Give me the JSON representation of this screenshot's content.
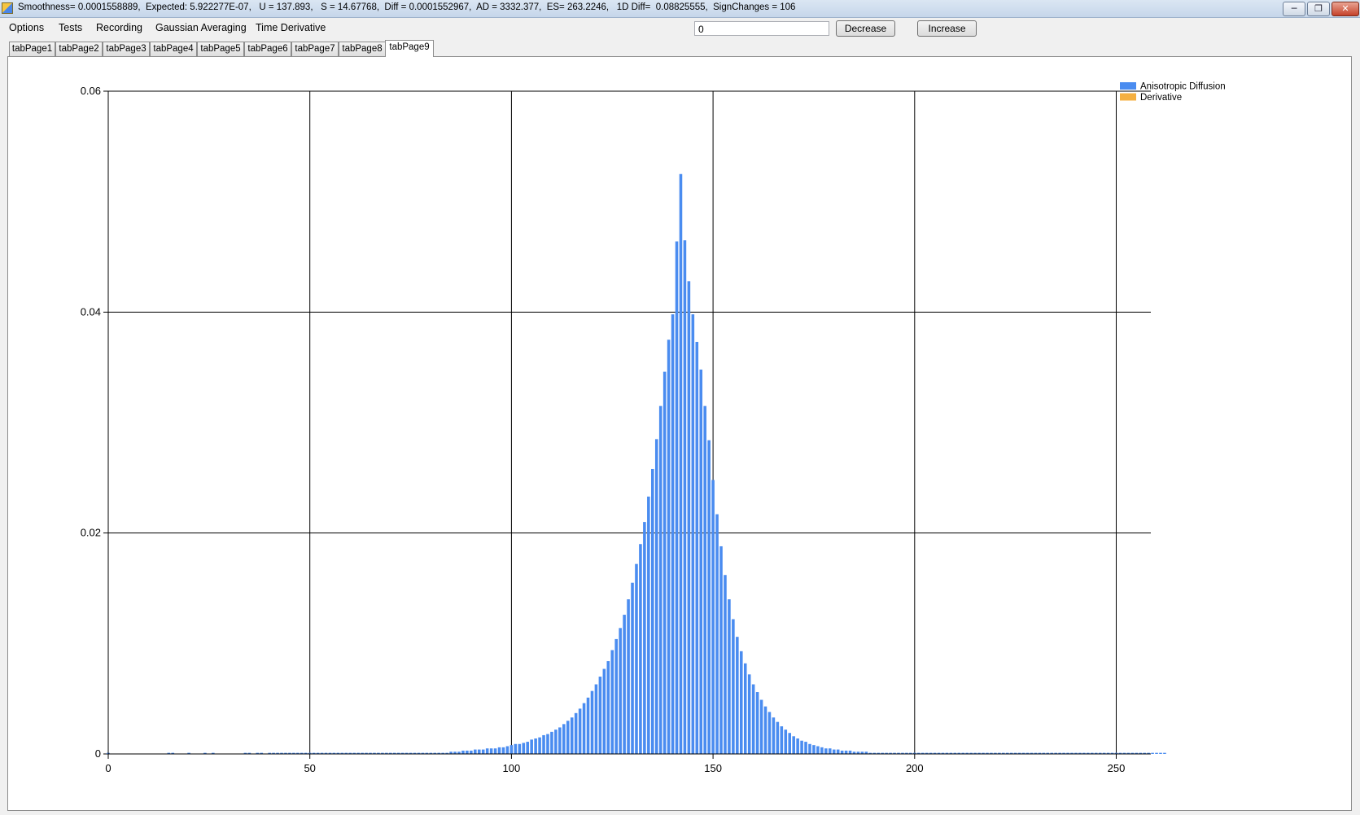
{
  "window": {
    "title": "Smoothness= 0.0001558889,  Expected: 5.922277E-07,   U = 137.893,   S = 14.67768,  Diff = 0.0001552967,  AD = 3332.377,  ES= 263.2246,   1D Diff=  0.08825555,  SignChanges = 106",
    "icons": {
      "app": "app-icon",
      "minimize": "minimize-icon",
      "restore": "restore-icon",
      "close": "close-icon"
    }
  },
  "menu": {
    "items": [
      {
        "label": "Options"
      },
      {
        "label": "Tests"
      },
      {
        "label": "Recording"
      },
      {
        "label": "Gaussian Averaging"
      },
      {
        "label": "Time Derivative"
      }
    ]
  },
  "toolbar": {
    "value": "0",
    "decrease_label": "Decrease",
    "increase_label": "Increase"
  },
  "tabs": [
    {
      "label": "tabPage1"
    },
    {
      "label": "tabPage2"
    },
    {
      "label": "tabPage3"
    },
    {
      "label": "tabPage4"
    },
    {
      "label": "tabPage5"
    },
    {
      "label": "tabPage6"
    },
    {
      "label": "tabPage7"
    },
    {
      "label": "tabPage8"
    },
    {
      "label": "tabPage9",
      "active": true
    }
  ],
  "chart_data": {
    "type": "bar",
    "title": "",
    "xlabel": "",
    "ylabel": "",
    "xlim": [
      0,
      255
    ],
    "ylim": [
      0,
      0.06
    ],
    "x_ticks": [
      0,
      50,
      100,
      150,
      200,
      250
    ],
    "x_tick_labels": [
      "0",
      "50",
      "100",
      "150",
      "200",
      "250"
    ],
    "y_ticks": [
      0,
      0.02,
      0.04,
      0.06
    ],
    "y_tick_labels": [
      "0",
      "0.02",
      "0.04",
      "0.06"
    ],
    "grid": true,
    "legend_position": "top-right",
    "series": [
      {
        "name": "Anisotropic Diffusion",
        "color": "#4a8cf0",
        "x_start": 0,
        "values": [
          0.0001,
          0,
          0,
          0,
          0,
          0,
          0,
          0,
          0,
          0,
          0,
          0,
          0,
          0,
          0,
          0.0001,
          0.0001,
          0,
          0,
          0,
          0.0001,
          0,
          0,
          0,
          0.0001,
          0,
          0.0001,
          0,
          0,
          0,
          0,
          0,
          0,
          0,
          0.0001,
          0.0001,
          0,
          0.0001,
          0.0001,
          0,
          0.0001,
          0.0001,
          0.0001,
          0.0001,
          0.0001,
          0.0001,
          0.0001,
          0.0001,
          0.0001,
          0.0001,
          0.0001,
          0.0001,
          0.0001,
          0.0001,
          0.0001,
          0.0001,
          0.0001,
          0.0001,
          0.0001,
          0.0001,
          0.0001,
          0.0001,
          0.0001,
          0.0001,
          0.0001,
          0.0001,
          0.0001,
          0.0001,
          0.0001,
          0.0001,
          0.0001,
          0.0001,
          0.0001,
          0.0001,
          0.0001,
          0.0001,
          0.0001,
          0.0001,
          0.0001,
          0.0001,
          0.0001,
          0.0001,
          0.0001,
          0.0001,
          0.0001,
          0.0002,
          0.0002,
          0.0002,
          0.0003,
          0.0003,
          0.0003,
          0.0004,
          0.0004,
          0.0004,
          0.0005,
          0.0005,
          0.0005,
          0.0006,
          0.0006,
          0.0007,
          0.0008,
          0.0009,
          0.0009,
          0.001,
          0.0011,
          0.0013,
          0.0014,
          0.0015,
          0.0017,
          0.0018,
          0.002,
          0.0022,
          0.0024,
          0.0027,
          0.003,
          0.0033,
          0.0037,
          0.0041,
          0.0046,
          0.0051,
          0.0057,
          0.0063,
          0.007,
          0.0077,
          0.0084,
          0.0094,
          0.0104,
          0.0114,
          0.0126,
          0.014,
          0.0155,
          0.0172,
          0.019,
          0.021,
          0.0233,
          0.0258,
          0.0285,
          0.0315,
          0.0346,
          0.0375,
          0.0398,
          0.0464,
          0.0525,
          0.0465,
          0.0428,
          0.0398,
          0.0373,
          0.0348,
          0.0315,
          0.0284,
          0.0248,
          0.0217,
          0.0188,
          0.0162,
          0.014,
          0.0122,
          0.0106,
          0.0093,
          0.0082,
          0.0072,
          0.0063,
          0.0056,
          0.0049,
          0.0043,
          0.0038,
          0.0033,
          0.0029,
          0.0025,
          0.0022,
          0.0019,
          0.0016,
          0.0014,
          0.0012,
          0.0011,
          0.0009,
          0.0008,
          0.0007,
          0.0006,
          0.0005,
          0.0005,
          0.0004,
          0.0004,
          0.0003,
          0.0003,
          0.0003,
          0.0002,
          0.0002,
          0.0002,
          0.0002,
          0.0001,
          0.0001,
          0.0001,
          0.0001,
          0.0001,
          0.0001,
          0.0001,
          0.0001,
          0.0001,
          0.0001,
          0.0001,
          0.0001,
          0.0001,
          0.0001,
          0.0001,
          0.0001,
          0.0001,
          0.0001,
          0.0001,
          0.0001,
          0.0001,
          0.0001,
          0.0001,
          0.0001,
          0.0001,
          0.0001,
          0.0001,
          0.0001,
          0.0001,
          0.0001,
          0.0001,
          0.0001,
          0.0001,
          0.0001,
          0.0001,
          0.0001,
          0.0001,
          0.0001,
          0.0001,
          0.0001,
          0.0001,
          0.0001,
          0.0001,
          0.0001,
          0.0001,
          0.0001,
          0.0001,
          0.0001,
          0.0001,
          0.0001,
          0.0001,
          0.0001,
          0.0001,
          0.0001,
          0.0001,
          0.0001,
          0.0001,
          0.0001,
          0.0001,
          0.0001,
          0.0001,
          0.0001,
          0.0001,
          0.0001,
          0.0001,
          0.0001,
          0.0001,
          0.0001,
          0.0001,
          0.0001,
          0.0001,
          0.0001,
          0.0001,
          0.0001
        ]
      },
      {
        "name": "Derivative",
        "color": "#f5b041",
        "values": []
      }
    ]
  }
}
